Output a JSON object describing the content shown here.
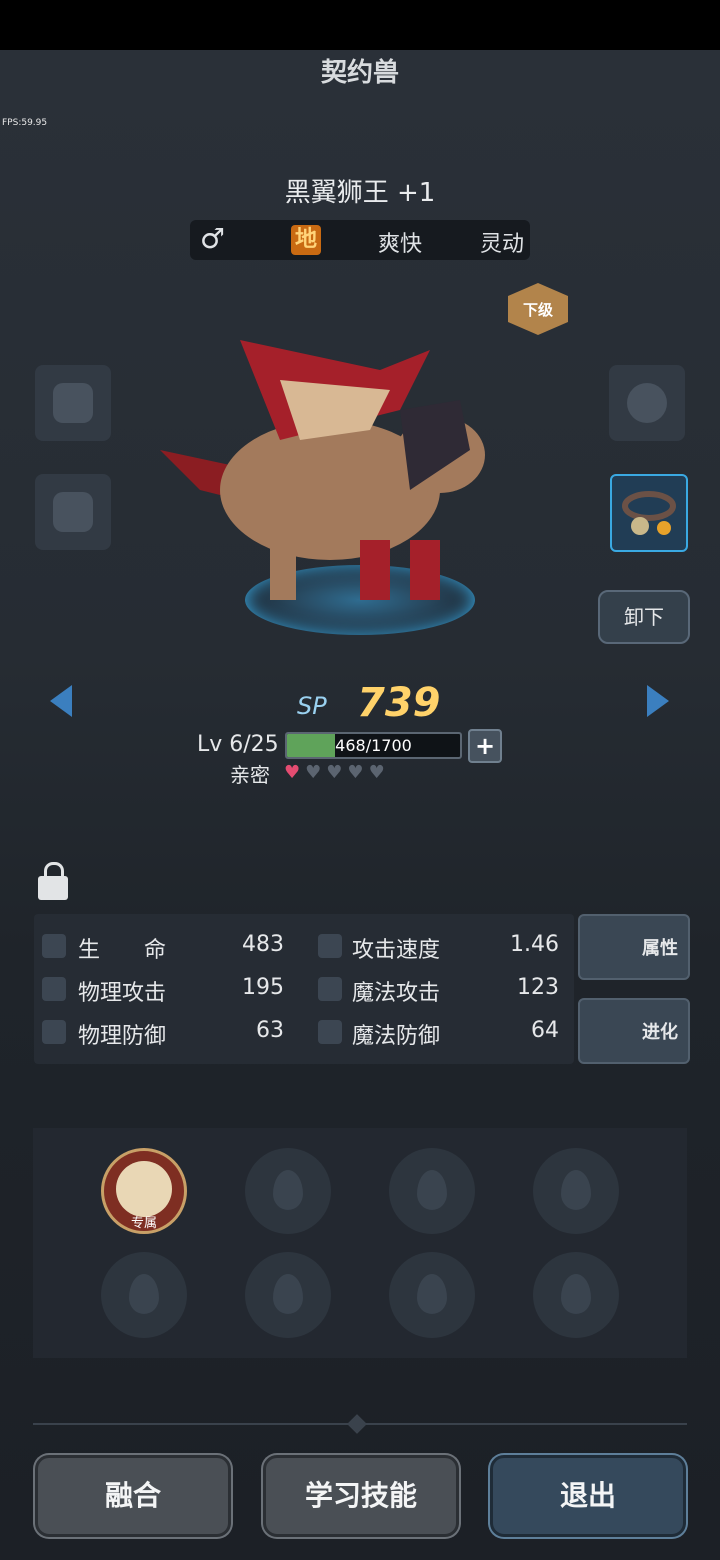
{
  "header": {
    "title": "契约兽",
    "fps": "FPS:59.95"
  },
  "pet": {
    "name": "黑翼狮王 +1",
    "gender_symbol": "♂",
    "element": "地",
    "trait1": "爽快",
    "trait2": "灵动",
    "grade_badge": "下级",
    "unequip_label": "卸下"
  },
  "sp": {
    "label": "SP",
    "value": "739"
  },
  "level": {
    "text": "Lv 6/25",
    "xp_text": "468/1700",
    "xp_fraction": 0.275
  },
  "intimacy": {
    "label": "亲密",
    "hearts_filled": 1,
    "hearts_total": 5
  },
  "stats": {
    "hp_label": "生　　命",
    "hp": "483",
    "atk_speed_label": "攻击速度",
    "atk_speed": "1.46",
    "phys_atk_label": "物理攻击",
    "phys_atk": "195",
    "magic_atk_label": "魔法攻击",
    "magic_atk": "123",
    "phys_def_label": "物理防御",
    "phys_def": "63",
    "magic_def_label": "魔法防御",
    "magic_def": "64"
  },
  "side_buttons": {
    "attributes": "属性",
    "evolve": "进化"
  },
  "skills": {
    "special_label": "专属"
  },
  "actions": {
    "fuse": "融合",
    "learn": "学习技能",
    "exit": "退出"
  },
  "colors": {
    "sp": "#ffd26a",
    "accent_blue": "#3aa9e2",
    "xp": "#5fa35a",
    "heart": "#e44c71"
  }
}
